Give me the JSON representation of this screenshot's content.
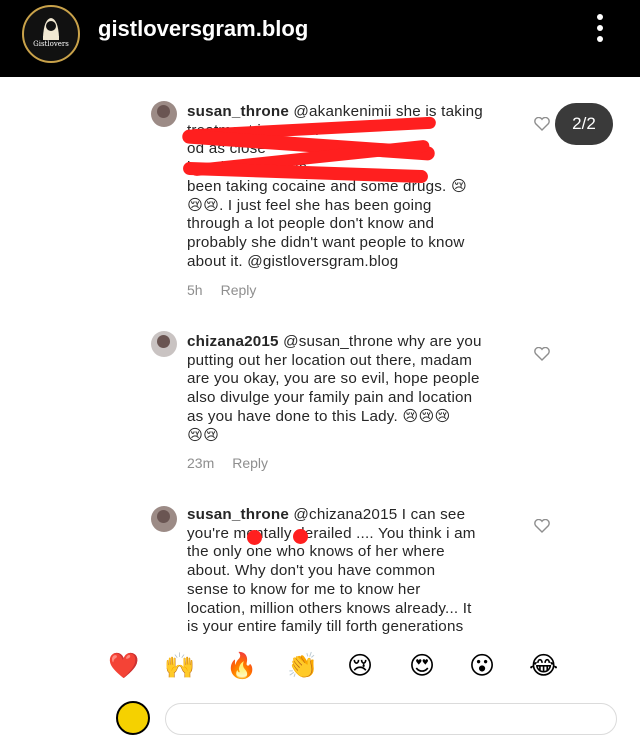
{
  "header": {
    "account_name": "gistloversgram.blog",
    "avatar_label": "Gistlovers",
    "more_icon": "vertical-ellipsis-icon"
  },
  "page_indicator": "2/2",
  "comments": [
    {
      "username": "susan_throne",
      "lines": [
        "@akankenimii  she is taking",
        "treatment in me        l H",
        "               od          as  close",
        "                    hospital. She has",
        "been taking cocaine and some drugs. 😢",
        "😢😢. I just feel she has been going",
        "through a lot people don't know and",
        "probably she didn't want people to know",
        "about it. @gistloversgram.blog"
      ],
      "time": "5h",
      "reply": "Reply"
    },
    {
      "username": "chizana2015",
      "lines": [
        "@susan_throne why are you",
        "putting out her location out there, madam",
        "are you okay, you are so evil, hope people",
        "also divulge your family pain and location",
        "as you have done to this Lady. 😢😢😢",
        "😢😢"
      ],
      "time": "23m",
      "reply": "Reply"
    },
    {
      "username": "susan_throne",
      "lines": [
        "@chizana2015 I can see",
        "you're mentally derailed .... You think i am",
        "the only one who knows of her where",
        "about. Why don't you have common",
        "sense to know for me to know her",
        "location, million others knows already... It",
        "is your entire family till forth generations"
      ]
    }
  ],
  "reactions": [
    "❤️",
    "🙌",
    "🔥",
    "👏",
    "😢",
    "😍",
    "😮",
    "😂"
  ]
}
